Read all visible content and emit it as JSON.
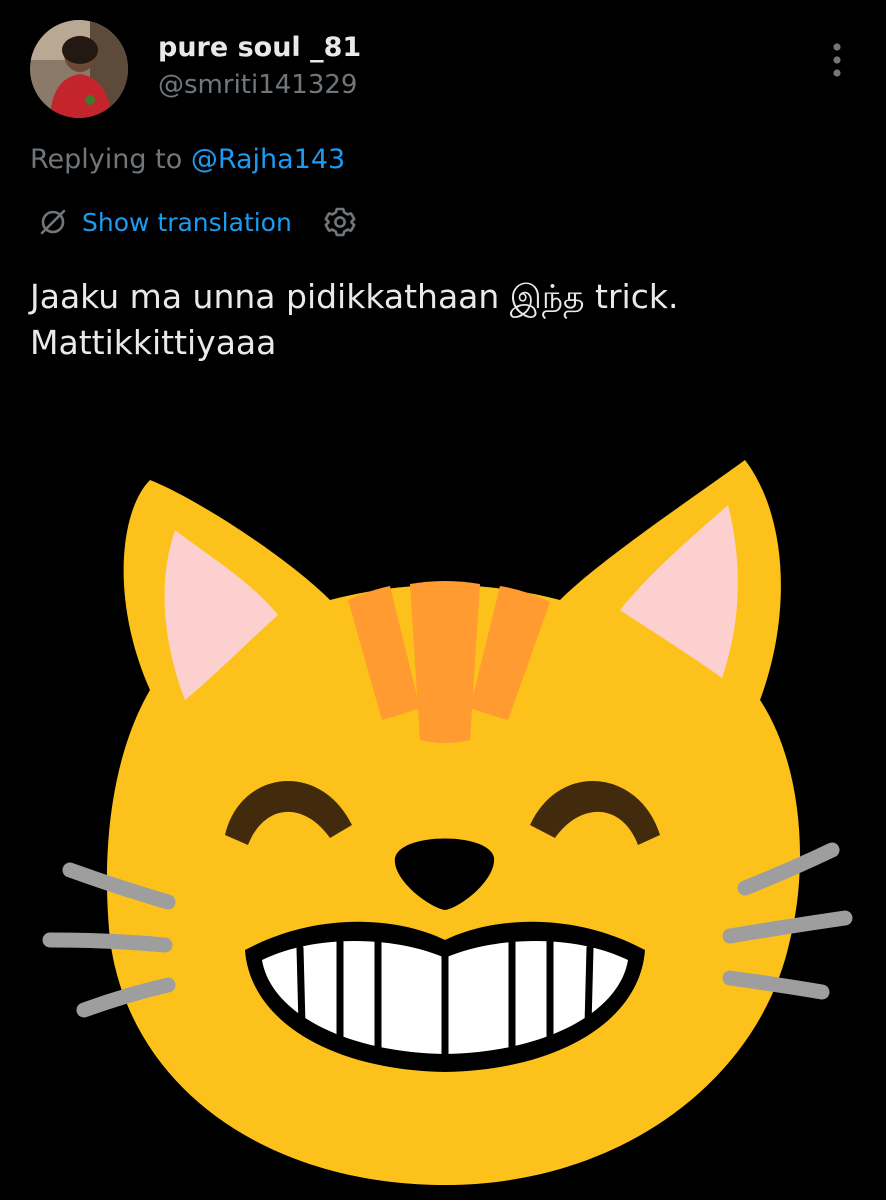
{
  "tweet": {
    "author": {
      "display_name": "pure soul _81",
      "handle": "@smriti141329"
    },
    "replying_prefix": "Replying to ",
    "replying_to": "@Rajha143",
    "translation_label": "Show translation",
    "text_line1": "Jaaku ma unna pidikkathaan  இந்த trick.",
    "text_line2": "Mattikkittiyaaa"
  },
  "icons": {
    "more": "more-vertical-icon",
    "translate": "globe-slash-icon",
    "settings": "gear-icon"
  },
  "colors": {
    "background": "#000000",
    "text_primary": "#e7e9ea",
    "text_secondary": "#71767b",
    "accent_link": "#1d9bf0",
    "cat_fur": "#fcc21b",
    "cat_stripes": "#ff9b31",
    "cat_ears_inner": "#fdd0d0",
    "cat_eyes": "#422b0d",
    "cat_whiskers": "#9e9e9e"
  }
}
